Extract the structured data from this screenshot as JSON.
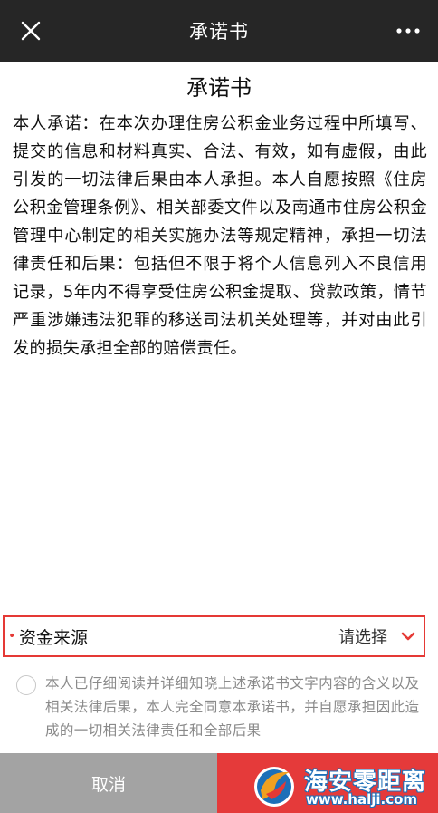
{
  "topbar": {
    "title": "承诺书",
    "close_icon": "close-icon",
    "more_icon": "more-dots-icon"
  },
  "document": {
    "heading": "承诺书",
    "body": "本人承诺：在本次办理住房公积金业务过程中所填写、提交的信息和材料真实、合法、有效，如有虚假，由此引发的一切法律后果由本人承担。本人自愿按照《住房公积金管理条例》、相关部委文件以及南通市住房公积金管理中心制定的相关实施办法等规定精神，承担一切法律责任和后果：包括但不限于将个人信息列入不良信用记录，5年内不得享受住房公积金提取、贷款政策，情节严重涉嫌违法犯罪的移送司法机关处理等，并对由此引发的损失承担全部的赔偿责任。"
  },
  "form": {
    "required_mark": "•",
    "fund_source_label": "资金来源",
    "fund_source_value": "请选择",
    "dropdown_icon": "chevron-down-icon"
  },
  "agreement": {
    "checked": false,
    "text": "本人已仔细阅读并详细知晓上述承诺书文字内容的含义以及相关法律后果，本人完全同意本承诺书，并自愿承担因此造成的一切相关法律责任和全部后果"
  },
  "buttons": {
    "cancel_label": "取消"
  },
  "watermark": {
    "brand": "海安零距离",
    "url": "www.halji.com"
  },
  "colors": {
    "topbar_bg": "#262626",
    "accent_red": "#e53935",
    "cancel_bg": "#a3a3a3",
    "confirm_bg": "#e53a3a"
  }
}
